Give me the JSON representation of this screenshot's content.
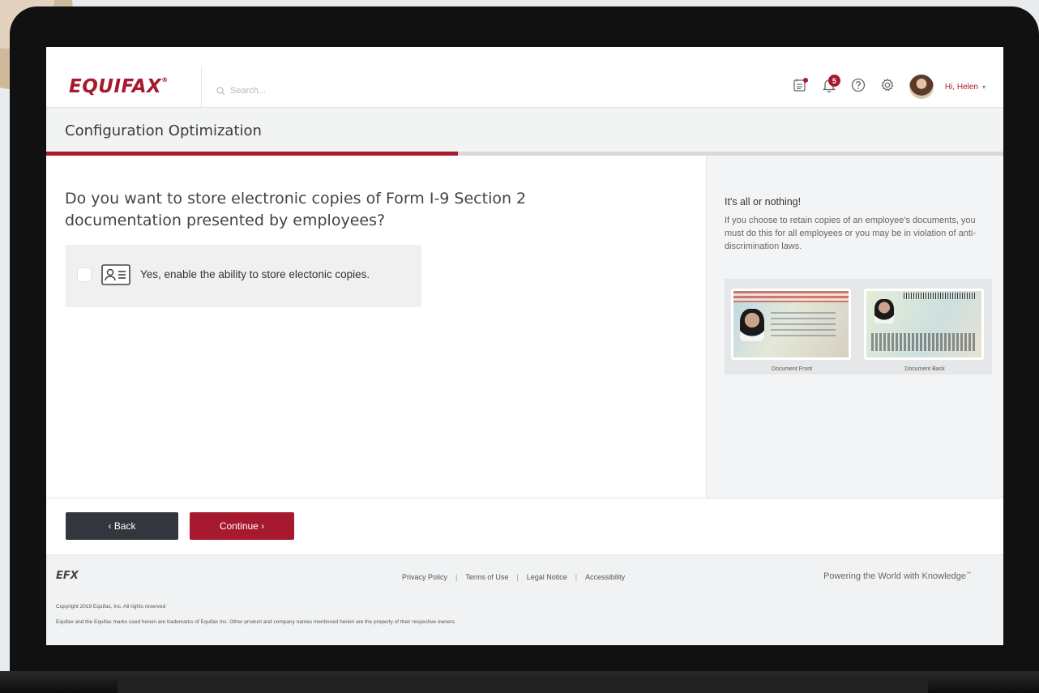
{
  "app": {
    "logo": "EQUIFAX",
    "logo_mark": "®",
    "search_placeholder": "Search..."
  },
  "header": {
    "notifications_count": "5",
    "greeting": "Hi, Helen",
    "icons": [
      "calendar-list-icon",
      "bell-icon",
      "help-icon",
      "gear-icon",
      "avatar",
      "chevron-down-icon"
    ]
  },
  "page": {
    "title": "Configuration Optimization",
    "progress_fraction": 0.43
  },
  "question": {
    "text": "Do you want to store electronic copies of Form I-9 Section 2 documentation presented by employees?",
    "option_label": "Yes, enable the ability to store electonic copies.",
    "option_checked": false
  },
  "side": {
    "title": "It's all or nothing!",
    "text": "If you choose to retain copies of an employee's documents, you must do this for all employees or you may be in violation of anti-discrimination laws.",
    "doc_front_caption": "Document Front",
    "doc_back_caption": "Document Back"
  },
  "buttons": {
    "back": "‹ Back",
    "continue": "Continue ›"
  },
  "footer": {
    "brand": "EFX",
    "links": [
      "Privacy Policy",
      "Terms of Use",
      "Legal Notice",
      "Accessibility"
    ],
    "separator": "|",
    "tagline": "Powering the World with Knowledge",
    "tagline_mark": "™",
    "copyright": "Copyright 2019 Equifax, Inc. All rights reserved",
    "legal": "Equifax and the Equifax marks used herein are trademarks of Equifax Inc. Other product and company names mentioned herein are the property of their respective owners."
  },
  "colors": {
    "brand": "#a6192e",
    "dark_button": "#33373d"
  }
}
